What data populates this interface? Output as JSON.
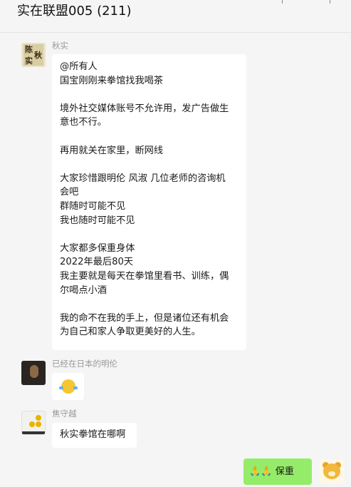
{
  "chat": {
    "title": "实在联盟005 (211)"
  },
  "messages": [
    {
      "sender": "秋实",
      "avatar_chars": [
        "陈",
        "秋",
        "实"
      ],
      "lines": [
        "@所有人",
        "国宝刚刚来拳馆找我喝茶",
        "",
        "境外社交媒体账号不允许用，发广告做生",
        "意也不行。",
        "",
        "再用就关在家里，断网线",
        "",
        "大家珍惜跟明伦 风淑 几位老师的咨询机",
        "会吧",
        "群随时可能不见",
        "我也随时可能不见",
        "",
        "大家都多保重身体",
        "2022年最后80天",
        "我主要就是每天在拳馆里看书、训练，偶",
        "尔喝点小酒",
        "",
        "我的命不在我的手上，但是诸位还有机会",
        "为自己和家人争取更美好的人生。"
      ]
    },
    {
      "sender": "已经在日本的明伦",
      "sticker": "crying-laughing-emoji"
    },
    {
      "sender": "焦守越",
      "text": "秋实拳馆在哪啊"
    }
  ],
  "my_message": {
    "text": "保重",
    "hands": "🙏🙏"
  },
  "colors": {
    "background": "#f5f5f5",
    "bubble_incoming": "#ffffff",
    "bubble_outgoing": "#95ec69",
    "sender_name": "#999999"
  }
}
